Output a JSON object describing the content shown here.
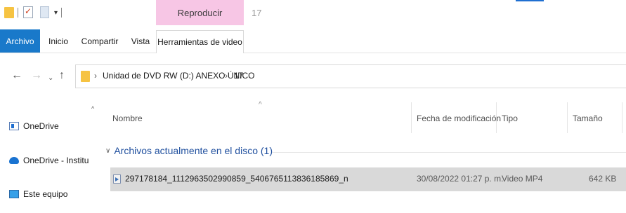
{
  "window": {
    "contextual_tab_group": "Reproducir",
    "title": "17"
  },
  "ribbon": {
    "tabs": [
      {
        "label": "Archivo"
      },
      {
        "label": "Inicio"
      },
      {
        "label": "Compartir"
      },
      {
        "label": "Vista"
      },
      {
        "label": "Herramientas de video"
      }
    ]
  },
  "address": {
    "crumbs": [
      "Unidad de DVD RW (D:) ANEXO ÚNICO",
      "17"
    ]
  },
  "navpane": {
    "items": [
      {
        "label": "OneDrive",
        "icon": "onedrive-icon"
      },
      {
        "label": "OneDrive - Institu",
        "icon": "onedrive-business-icon"
      },
      {
        "label": "Este equipo",
        "icon": "this-pc-icon"
      }
    ]
  },
  "filelist": {
    "columns": [
      "Nombre",
      "Fecha de modificación",
      "Tipo",
      "Tamaño"
    ],
    "sorted_by": "Nombre",
    "group": "Archivos actualmente en el disco (1)",
    "rows": [
      {
        "name": "297178184_1112963502990859_5406765113836185869_n",
        "date": "30/08/2022 01:27 p. m.",
        "type": "Video MP4",
        "size": "642 KB",
        "icon": "video-file-icon",
        "selected": true
      }
    ]
  },
  "colors": {
    "file_tab": "#1979ca",
    "contextual_tab": "#f7c6e5",
    "group_header": "#1f4f9e",
    "selected_row": "#d9d9d9"
  }
}
